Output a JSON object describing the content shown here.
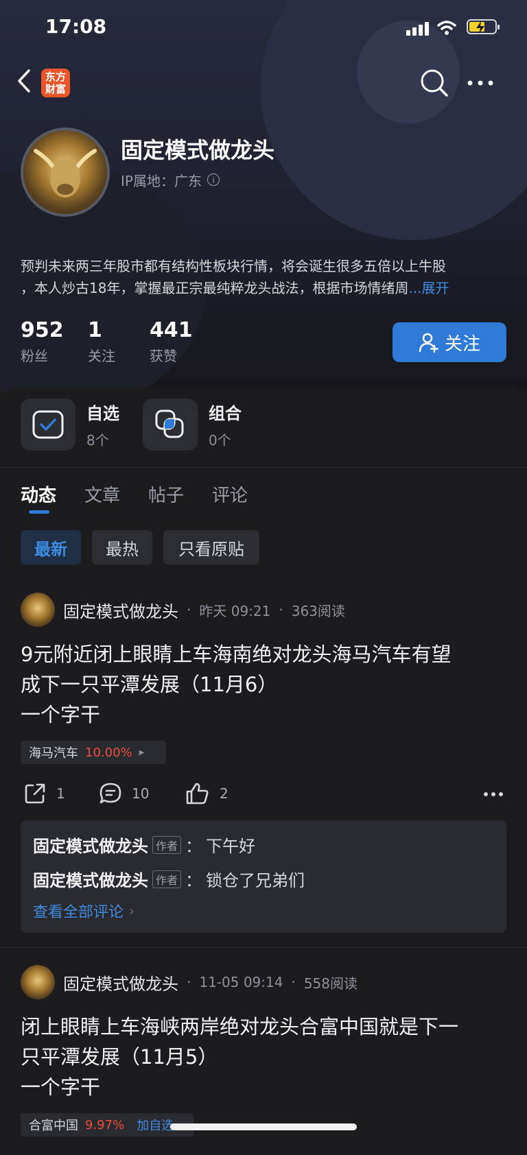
{
  "status_bar": {
    "time": "17:08"
  },
  "header": {
    "logo_text_line1": "东方",
    "logo_text_line2": "财富"
  },
  "profile": {
    "name": "固定模式做龙头",
    "ip_location": "IP属地：广东",
    "bio_line1": "预判未来两三年股市都有结构性板块行情，将会诞生很多五倍以上牛股",
    "bio_line2": "，本人炒古18年，掌握最正宗最纯粹龙头战法，根据市场情绪周",
    "bio_more": "...展开",
    "stats": [
      {
        "value": "952",
        "label": "粉丝"
      },
      {
        "value": "1",
        "label": "关注"
      },
      {
        "value": "441",
        "label": "获赞"
      }
    ],
    "follow_label": "关注"
  },
  "tools": [
    {
      "title": "自选",
      "sub": "8个",
      "icon": "checkbox-icon"
    },
    {
      "title": "组合",
      "sub": "0个",
      "icon": "layers-icon"
    }
  ],
  "tabs": [
    "动态",
    "文章",
    "帖子",
    "评论"
  ],
  "filters": [
    "最新",
    "最热",
    "只看原贴"
  ],
  "posts": [
    {
      "author": "固定模式做龙头",
      "time": "昨天 09:21",
      "reads": "363阅读",
      "title_line1": "9元附近闭上眼睛上车海南绝对龙头海马汽车有望",
      "title_line2": "成下一只平潭发展（11月6）",
      "title_line3": "一个字干",
      "stock_name": "海马汽车",
      "stock_change": "10.00%",
      "shares": "1",
      "comments": "10",
      "likes": "2",
      "comment_preview": [
        {
          "author": "固定模式做龙头",
          "tag": "作者",
          "text": "下午好"
        },
        {
          "author": "固定模式做龙头",
          "tag": "作者",
          "text": "锁仓了兄弟们"
        }
      ],
      "view_all": "查看全部评论"
    },
    {
      "author": "固定模式做龙头",
      "time": "11-05 09:14",
      "reads": "558阅读",
      "title_line1": "闭上眼睛上车海峡两岸绝对龙头合富中国就是下一",
      "title_line2": "只平潭发展（11月5）",
      "title_line3": "一个字干",
      "stock_name": "合富中国",
      "stock_change": "9.97%",
      "stock_action": "加自选"
    }
  ],
  "colors": {
    "accent": "#2f79d7",
    "up": "#ef4b3a",
    "background": "#1c1c1e"
  }
}
